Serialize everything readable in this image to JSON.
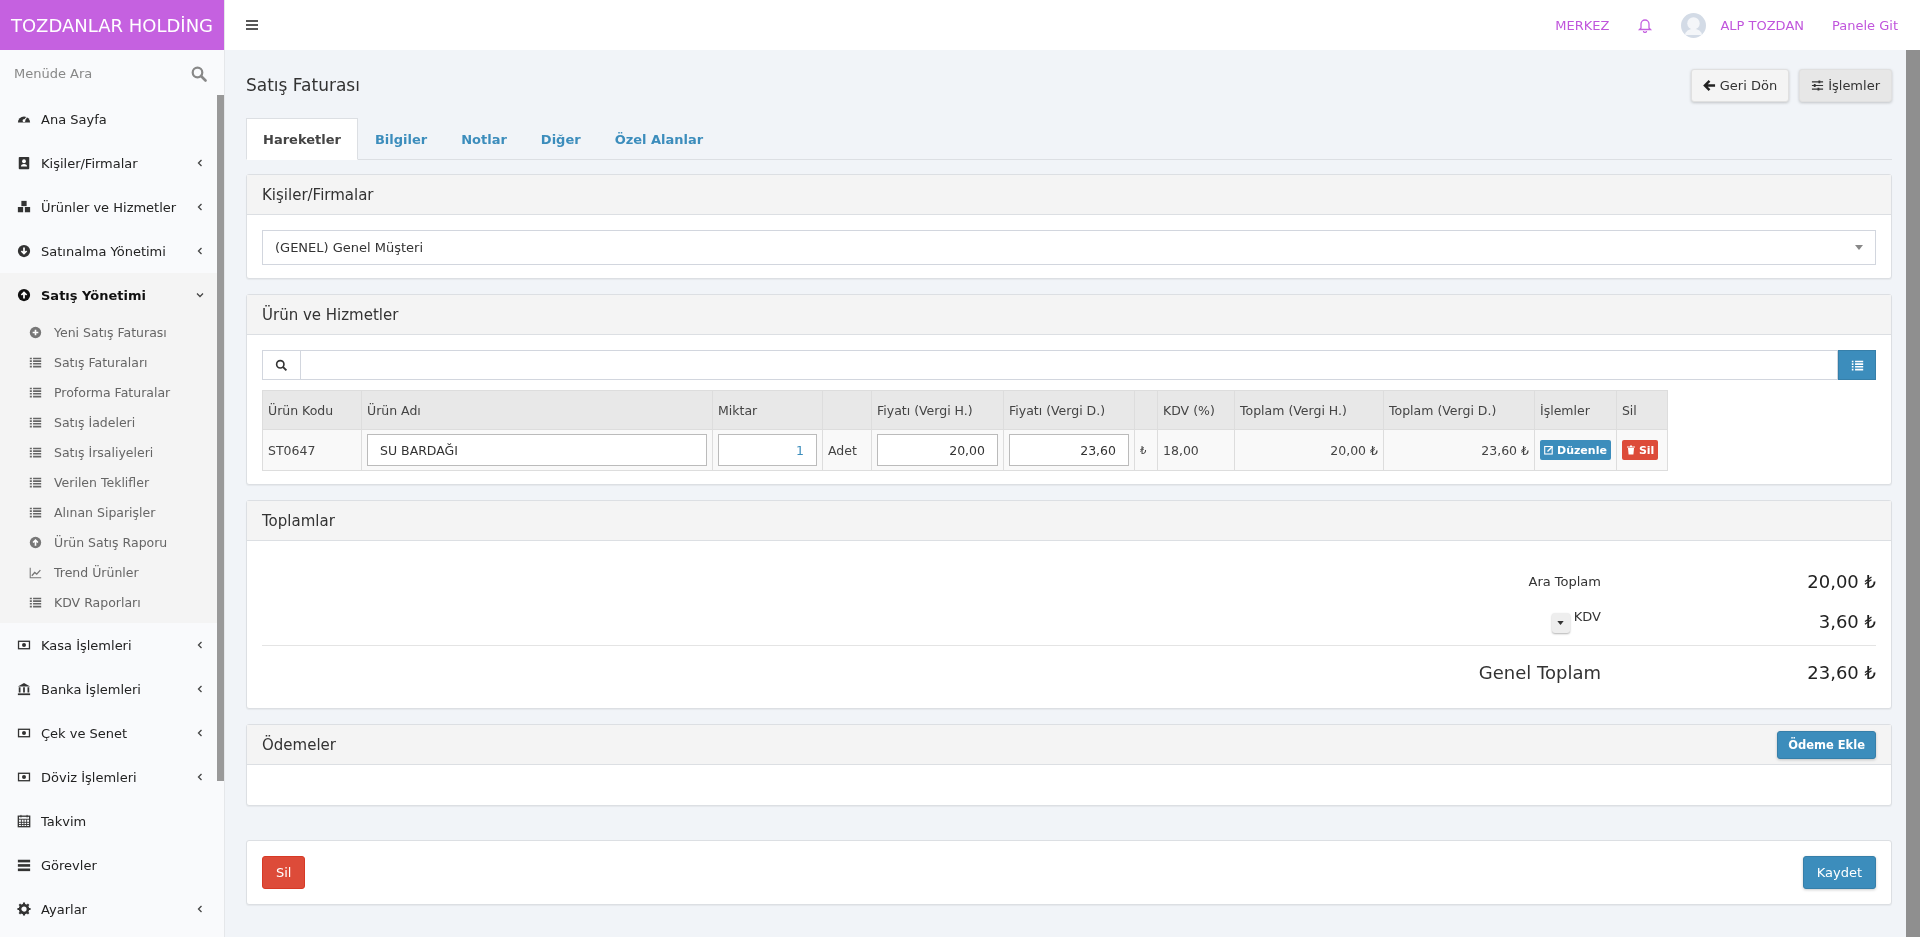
{
  "brand": "TOZDANLAR HOLDİNG",
  "sidebar": {
    "search_placeholder": "Menüde Ara",
    "items": [
      {
        "label": "Ana Sayfa",
        "expandable": false,
        "expanded": false
      },
      {
        "label": "Kişiler/Firmalar",
        "expandable": true,
        "expanded": false
      },
      {
        "label": "Ürünler ve Hizmetler",
        "expandable": true,
        "expanded": false
      },
      {
        "label": "Satınalma Yönetimi",
        "expandable": true,
        "expanded": false
      },
      {
        "label": "Satış Yönetimi",
        "expandable": true,
        "expanded": true,
        "children": [
          {
            "label": "Yeni Satış Faturası"
          },
          {
            "label": "Satış Faturaları"
          },
          {
            "label": "Proforma Faturalar"
          },
          {
            "label": "Satış İadeleri"
          },
          {
            "label": "Satış İrsaliyeleri"
          },
          {
            "label": "Verilen Teklifler"
          },
          {
            "label": "Alınan Siparişler"
          },
          {
            "label": "Ürün Satış Raporu"
          },
          {
            "label": "Trend Ürünler"
          },
          {
            "label": "KDV Raporları"
          }
        ]
      },
      {
        "label": "Kasa İşlemleri",
        "expandable": true,
        "expanded": false
      },
      {
        "label": "Banka İşlemleri",
        "expandable": true,
        "expanded": false
      },
      {
        "label": "Çek ve Senet",
        "expandable": true,
        "expanded": false
      },
      {
        "label": "Döviz İşlemleri",
        "expandable": true,
        "expanded": false
      },
      {
        "label": "Takvim",
        "expandable": false,
        "expanded": false
      },
      {
        "label": "Görevler",
        "expandable": false,
        "expanded": false
      },
      {
        "label": "Ayarlar",
        "expandable": true,
        "expanded": false
      }
    ]
  },
  "topbar": {
    "branch": "MERKEZ",
    "user": "ALP TOZDAN",
    "panel_link": "Panele Git"
  },
  "page": {
    "title": "Satış Faturası",
    "back_button": "Geri Dön",
    "actions_button": "İşlemler"
  },
  "tabs": [
    {
      "label": "Hareketler",
      "selected": true
    },
    {
      "label": "Bilgiler",
      "selected": false
    },
    {
      "label": "Notlar",
      "selected": false
    },
    {
      "label": "Diğer",
      "selected": false
    },
    {
      "label": "Özel Alanlar",
      "selected": false
    }
  ],
  "customer_panel": {
    "title": "Kişiler/Firmalar",
    "value": "(GENEL) Genel Müşteri"
  },
  "products_panel": {
    "title": "Ürün ve Hizmetler",
    "columns": [
      "Ürün Kodu",
      "Ürün Adı",
      "Miktar",
      "Fiyatı (Vergi H.)",
      "Fiyatı (Vergi D.)",
      "KDV (%)",
      "Toplam (Vergi H.)",
      "Toplam (Vergi D.)",
      "İşlemler",
      "Sil"
    ],
    "rows": [
      {
        "code": "ST0647",
        "name": "SU BARDAĞI",
        "quantity": "1",
        "unit": "Adet",
        "price_excl": "20,00",
        "price_incl": "23,60",
        "currency": "₺",
        "vat": "18,00",
        "total_excl": "20,00 ₺",
        "total_incl": "23,60 ₺",
        "edit_button": "Düzenle",
        "delete_button": "Sil"
      }
    ]
  },
  "totals_panel": {
    "title": "Toplamlar",
    "subtotal_label": "Ara Toplam",
    "subtotal": "20,00 ₺",
    "vat_label": "KDV",
    "vat": "3,60 ₺",
    "grand_total_label": "Genel Toplam",
    "grand_total": "23,60 ₺"
  },
  "payments_panel": {
    "title": "Ödemeler",
    "add_button": "Ödeme Ekle"
  },
  "footer": {
    "delete_button": "Sil",
    "save_button": "Kaydet"
  }
}
